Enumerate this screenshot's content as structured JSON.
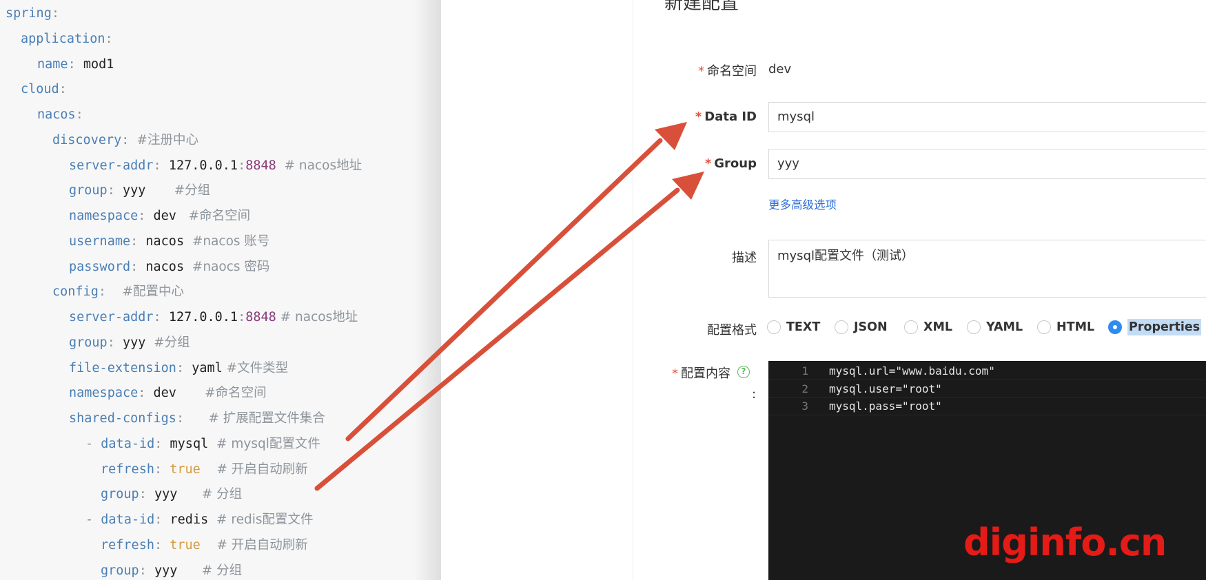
{
  "yaml_lines": [
    [
      [
        "k",
        "spring"
      ],
      [
        "p",
        ":"
      ]
    ],
    [
      [
        "k",
        "application"
      ],
      [
        "p",
        ":"
      ]
    ],
    [
      [
        "k",
        "name"
      ],
      [
        "p",
        ": "
      ],
      [
        "v",
        "mod1"
      ]
    ],
    [
      [
        "k",
        "cloud"
      ],
      [
        "p",
        ":"
      ]
    ],
    [
      [
        "k",
        "nacos"
      ],
      [
        "p",
        ":"
      ]
    ],
    [
      [
        "k",
        "discovery"
      ],
      [
        "p",
        ": "
      ],
      [
        "c",
        "#注册中心"
      ]
    ],
    [
      [
        "k",
        "server-addr"
      ],
      [
        "p",
        ": "
      ],
      [
        "v",
        "127.0.0.1"
      ],
      [
        "p",
        ":"
      ],
      [
        "n",
        "8848"
      ],
      [
        "c",
        "  # nacos地址"
      ]
    ],
    [
      [
        "k",
        "group"
      ],
      [
        "p",
        ": "
      ],
      [
        "v",
        "yyy"
      ],
      [
        "c",
        "       #分组"
      ]
    ],
    [
      [
        "k",
        "namespace"
      ],
      [
        "p",
        ": "
      ],
      [
        "v",
        "dev"
      ],
      [
        "c",
        "   #命名空间"
      ]
    ],
    [
      [
        "k",
        "username"
      ],
      [
        "p",
        ": "
      ],
      [
        "v",
        "nacos"
      ],
      [
        "c",
        "  #nacos 账号"
      ]
    ],
    [
      [
        "k",
        "password"
      ],
      [
        "p",
        ": "
      ],
      [
        "v",
        "nacos"
      ],
      [
        "c",
        "  #naocs 密码"
      ]
    ],
    [
      [
        "k",
        "config"
      ],
      [
        "p",
        ":"
      ],
      [
        "c",
        "    #配置中心"
      ]
    ],
    [
      [
        "k",
        "server-addr"
      ],
      [
        "p",
        ": "
      ],
      [
        "v",
        "127.0.0.1"
      ],
      [
        "p",
        ":"
      ],
      [
        "n",
        "8848"
      ],
      [
        "c",
        " # nacos地址"
      ]
    ],
    [
      [
        "k",
        "group"
      ],
      [
        "p",
        ": "
      ],
      [
        "v",
        "yyy"
      ],
      [
        "c",
        "  #分组"
      ]
    ],
    [
      [
        "k",
        "file-extension"
      ],
      [
        "p",
        ": "
      ],
      [
        "v",
        "yaml"
      ],
      [
        "c",
        " #文件类型"
      ]
    ],
    [
      [
        "k",
        "namespace"
      ],
      [
        "p",
        ": "
      ],
      [
        "v",
        "dev"
      ],
      [
        "c",
        "       #命名空间"
      ]
    ],
    [
      [
        "k",
        "shared-configs"
      ],
      [
        "p",
        ":"
      ],
      [
        "c",
        "      # 扩展配置文件集合"
      ]
    ],
    [
      [
        "p",
        "- "
      ],
      [
        "k",
        "data-id"
      ],
      [
        "p",
        ": "
      ],
      [
        "v",
        "mysql"
      ],
      [
        "c",
        "  # mysql配置文件"
      ]
    ],
    [
      [
        "k",
        "refresh"
      ],
      [
        "p",
        ": "
      ],
      [
        "b",
        "true"
      ],
      [
        "c",
        "    # 开启自动刷新"
      ]
    ],
    [
      [
        "k",
        "group"
      ],
      [
        "p",
        ": "
      ],
      [
        "v",
        "yyy"
      ],
      [
        "c",
        "      # 分组"
      ]
    ],
    [
      [
        "p",
        "- "
      ],
      [
        "k",
        "data-id"
      ],
      [
        "p",
        ": "
      ],
      [
        "v",
        "redis"
      ],
      [
        "c",
        "  # redis配置文件"
      ]
    ],
    [
      [
        "k",
        "refresh"
      ],
      [
        "p",
        ": "
      ],
      [
        "b",
        "true"
      ],
      [
        "c",
        "    # 开启自动刷新"
      ]
    ],
    [
      [
        "k",
        "group"
      ],
      [
        "p",
        ": "
      ],
      [
        "v",
        "yyy"
      ],
      [
        "c",
        "      # 分组"
      ]
    ]
  ],
  "form": {
    "title": "新建配置",
    "namespace": {
      "label": "命名空间",
      "value": "dev"
    },
    "data_id": {
      "label": "Data ID",
      "value": "mysql"
    },
    "group": {
      "label": "Group",
      "value": "yyy"
    },
    "advanced_link": "更多高级选项",
    "description": {
      "label": "描述",
      "value": "mysql配置文件（测试）"
    },
    "format": {
      "label": "配置格式",
      "options": [
        "TEXT",
        "JSON",
        "XML",
        "YAML",
        "HTML",
        "Properties"
      ],
      "selected": "Properties"
    },
    "content": {
      "label": "配置内容",
      "colon": ":",
      "help_icon": "question-icon",
      "lines": [
        {
          "num": "1",
          "text": "mysql.url=\"www.baidu.com\""
        },
        {
          "num": "2",
          "text": "mysql.user=\"root\""
        },
        {
          "num": "3",
          "text": "mysql.pass=\"root\""
        }
      ]
    },
    "required_mark": "*"
  },
  "watermark": "diginfo.cn",
  "colors": {
    "arrow": "#d9503a",
    "selected_radio": "#2f8bf0",
    "required": "#e0513a",
    "link": "#2f6fd9",
    "watermark": "#e41b17"
  }
}
